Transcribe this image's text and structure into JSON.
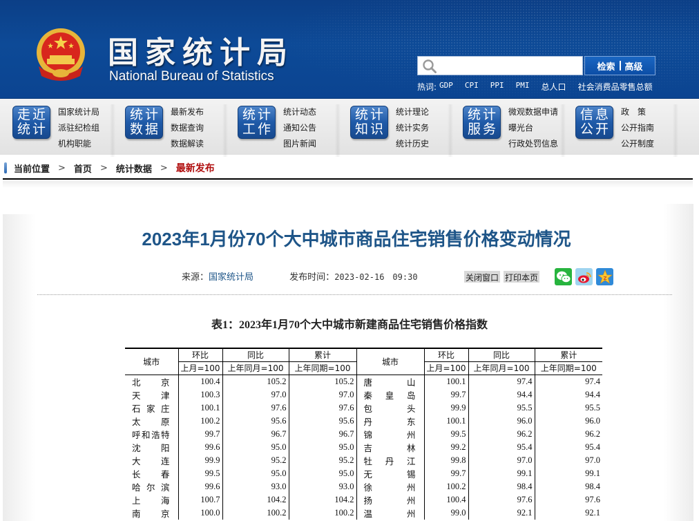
{
  "header": {
    "logo_cn": "国家统计局",
    "logo_en": "National Bureau of Statistics",
    "search": {
      "placeholder": "",
      "value": "",
      "search_label": "检索",
      "advanced_label": "高级"
    },
    "hotwords_label": "热词:",
    "hotwords": [
      "GDP",
      "CPI",
      "PPI",
      "PMI",
      "总人口",
      "社会消费品零售总额"
    ]
  },
  "nav": [
    {
      "badge": [
        "走近",
        "统计"
      ],
      "links": [
        "国家统计局",
        "派驻纪检组",
        "机构职能"
      ]
    },
    {
      "badge": [
        "统计",
        "数据"
      ],
      "links": [
        "最新发布",
        "数据查询",
        "数据解读"
      ]
    },
    {
      "badge": [
        "统计",
        "工作"
      ],
      "links": [
        "统计动态",
        "通知公告",
        "图片新闻"
      ]
    },
    {
      "badge": [
        "统计",
        "知识"
      ],
      "links": [
        "统计理论",
        "统计实务",
        "统计历史"
      ]
    },
    {
      "badge": [
        "统计",
        "服务"
      ],
      "links": [
        "微观数据申请",
        "曝光台",
        "行政处罚信息"
      ]
    },
    {
      "badge": [
        "信息",
        "公开"
      ],
      "links": [
        "政　策",
        "公开指南",
        "公开制度"
      ]
    }
  ],
  "breadcrumb": {
    "label": "当前位置",
    "items": [
      "首页",
      "统计数据"
    ],
    "current": "最新发布",
    "separator": ">"
  },
  "article": {
    "title": "2023年1月份70个大中城市商品住宅销售价格变动情况",
    "source_label": "来源：",
    "source": "国家统计局",
    "time_label": "发布时间：",
    "time": "2023-02-16　09:30",
    "close_label": "关闭窗口",
    "print_label": "打印本页",
    "share": [
      "wechat",
      "weibo",
      "qzone"
    ]
  },
  "table": {
    "caption": "表1：2023年1月70个大中城市新建商品住宅销售价格指数",
    "headers": {
      "city": "城市",
      "mom": "环比",
      "mom_base": "上月=100",
      "yoy": "同比",
      "yoy_base": "上年同月=100",
      "cum": "累计",
      "cum_base": "上年同期=100"
    },
    "rows": [
      {
        "l": [
          "北　京",
          "100.4",
          "105.2",
          "105.2"
        ],
        "r": [
          "唐　山",
          "100.1",
          "97.4",
          "97.4"
        ]
      },
      {
        "l": [
          "天　津",
          "100.3",
          "97.0",
          "97.0"
        ],
        "r": [
          "秦皇岛",
          "99.7",
          "94.4",
          "94.4"
        ]
      },
      {
        "l": [
          "石家庄",
          "100.1",
          "97.6",
          "97.6"
        ],
        "r": [
          "包　头",
          "99.9",
          "95.5",
          "95.5"
        ]
      },
      {
        "l": [
          "太　原",
          "100.2",
          "95.6",
          "95.6"
        ],
        "r": [
          "丹　东",
          "100.1",
          "96.0",
          "96.0"
        ]
      },
      {
        "l": [
          "呼和浩特",
          "99.7",
          "96.7",
          "96.7"
        ],
        "r": [
          "锦　州",
          "99.5",
          "96.2",
          "96.2"
        ]
      },
      {
        "l": [
          "沈　阳",
          "99.6",
          "95.0",
          "95.0"
        ],
        "r": [
          "吉　林",
          "99.2",
          "95.4",
          "95.4"
        ]
      },
      {
        "l": [
          "大　连",
          "99.9",
          "95.2",
          "95.2"
        ],
        "r": [
          "牡丹江",
          "99.8",
          "97.0",
          "97.0"
        ]
      },
      {
        "l": [
          "长　春",
          "99.5",
          "95.0",
          "95.0"
        ],
        "r": [
          "无　锡",
          "99.7",
          "99.1",
          "99.1"
        ]
      },
      {
        "l": [
          "哈尔滨",
          "99.6",
          "93.0",
          "93.0"
        ],
        "r": [
          "徐　州",
          "100.2",
          "98.4",
          "98.4"
        ]
      },
      {
        "l": [
          "上　海",
          "100.7",
          "104.2",
          "104.2"
        ],
        "r": [
          "扬　州",
          "100.4",
          "97.6",
          "97.6"
        ]
      },
      {
        "l": [
          "南　京",
          "100.0",
          "100.2",
          "100.2"
        ],
        "r": [
          "温　州",
          "99.0",
          "92.1",
          "92.1"
        ]
      }
    ]
  }
}
